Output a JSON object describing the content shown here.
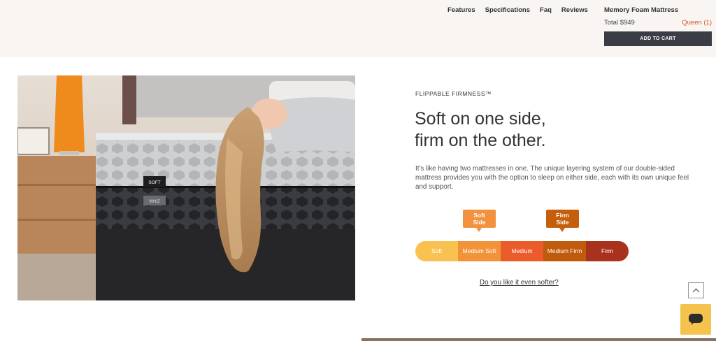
{
  "nav": {
    "items": [
      "Features",
      "Specifications",
      "Faq",
      "Reviews"
    ]
  },
  "product": {
    "name": "Memory Foam Mattress",
    "total": "Total $949",
    "variant": "Queen (1)",
    "add_to_cart": "ADD TO CART"
  },
  "hero": {
    "image_tag_top": "SOFT",
    "image_tag_bottom": "WHIZ"
  },
  "section": {
    "eyebrow": "FLIPPABLE FIRMNESS™",
    "headline_line1": "Soft on one side,",
    "headline_line2": "firm on the other.",
    "description": "It's like having two mattresses in one. The unique layering system of our double-sided mattress provides you with the option to sleep on either side, each with its own unique feel and support."
  },
  "firmness": {
    "soft_bubble_line1": "Soft",
    "soft_bubble_line2": "Side",
    "firm_bubble_line1": "Firm",
    "firm_bubble_line2": "Side",
    "scale": [
      {
        "label": "Soft",
        "color": "#f9c150"
      },
      {
        "label": "Medium Soft",
        "color": "#f39339"
      },
      {
        "label": "Medium",
        "color": "#ec5c2b"
      },
      {
        "label": "Medium Firm",
        "color": "#c05b0c"
      },
      {
        "label": "Firm",
        "color": "#a8321c"
      }
    ]
  },
  "links": {
    "softer": "Do you like it even softer?"
  },
  "colors": {
    "header_bg": "#f8f5f3",
    "cart_button": "#3a3d45",
    "variant_accent": "#d4572a",
    "chat_button": "#f5c24d"
  },
  "icons": {
    "scroll_top": "chevron-up-icon",
    "chat": "chat-bubble-icon"
  }
}
